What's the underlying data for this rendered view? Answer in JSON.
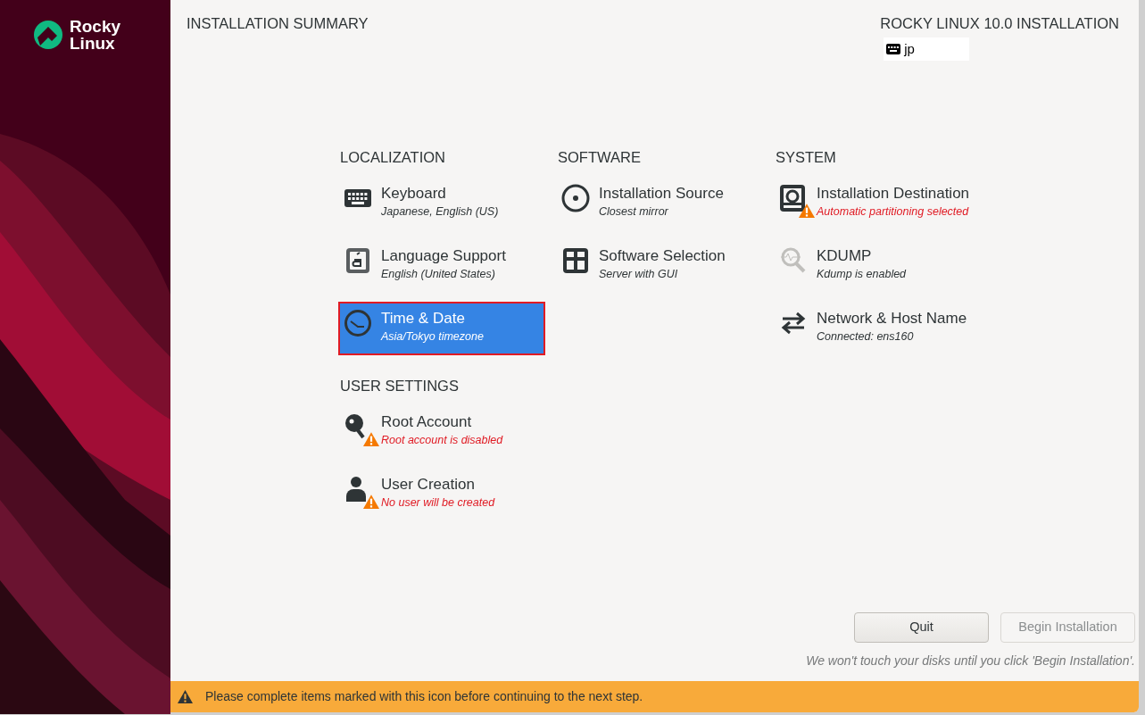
{
  "logo": {
    "line1": "Rocky",
    "line2": "Linux"
  },
  "header": {
    "title": "INSTALLATION SUMMARY",
    "product": "ROCKY LINUX 10.0 INSTALLATION",
    "keyboard_layout": "jp"
  },
  "sections": [
    {
      "title": "LOCALIZATION",
      "items": [
        {
          "title": "Keyboard",
          "status": "Japanese, English (US)",
          "warning": false,
          "selected": false
        },
        {
          "title": "Language Support",
          "status": "English (United States)",
          "warning": false,
          "selected": false
        },
        {
          "title": "Time & Date",
          "status": "Asia/Tokyo timezone",
          "warning": false,
          "selected": true
        }
      ]
    },
    {
      "title": "SOFTWARE",
      "items": [
        {
          "title": "Installation Source",
          "status": "Closest mirror",
          "warning": false,
          "selected": false
        },
        {
          "title": "Software Selection",
          "status": "Server with GUI",
          "warning": false,
          "selected": false
        }
      ]
    },
    {
      "title": "SYSTEM",
      "items": [
        {
          "title": "Installation Destination",
          "status": "Automatic partitioning selected",
          "warning": true,
          "selected": false
        },
        {
          "title": "KDUMP",
          "status": "Kdump is enabled",
          "warning": false,
          "selected": false
        },
        {
          "title": "Network & Host Name",
          "status": "Connected: ens160",
          "warning": false,
          "selected": false
        }
      ]
    },
    {
      "title": "USER SETTINGS",
      "items": [
        {
          "title": "Root Account",
          "status": "Root account is disabled",
          "warning": true,
          "selected": false
        },
        {
          "title": "User Creation",
          "status": "No user will be created",
          "warning": true,
          "selected": false
        }
      ]
    }
  ],
  "buttons": [
    {
      "label": "Quit",
      "disabled": false
    },
    {
      "label": "Begin Installation",
      "disabled": true
    }
  ],
  "note": "We won't touch your disks until you click 'Begin Installation'.",
  "warning_bar": {
    "message": "Please complete items marked with this icon before continuing to the next step."
  }
}
